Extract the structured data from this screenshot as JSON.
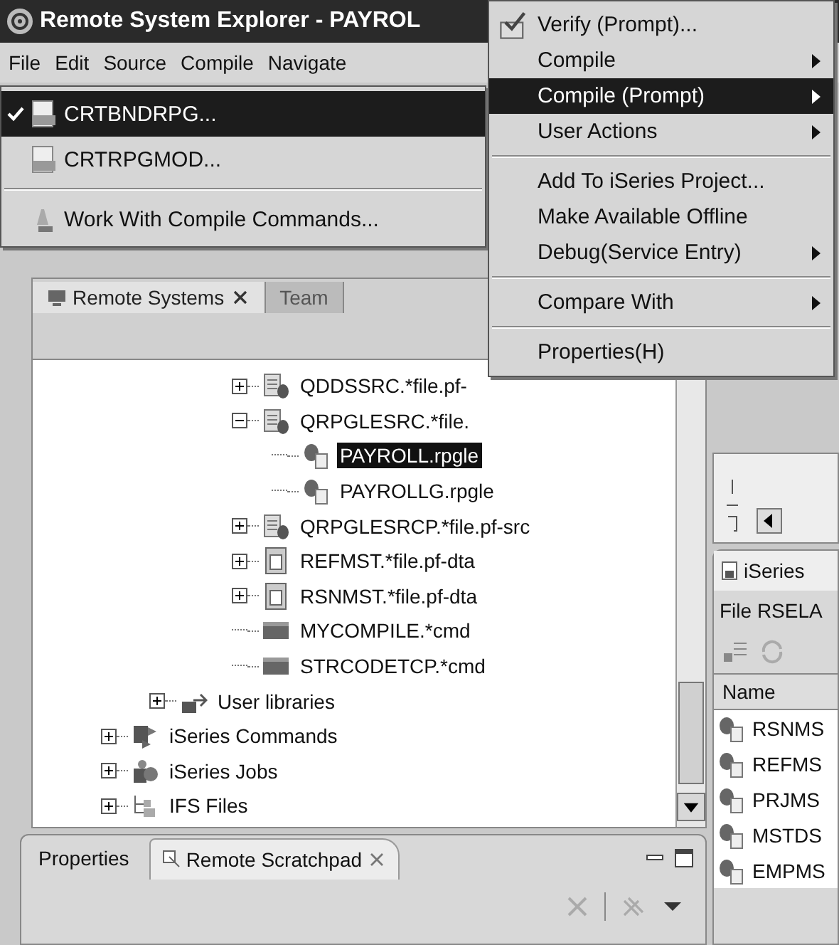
{
  "window": {
    "title": "Remote System Explorer - PAYROL"
  },
  "menu_bar": [
    "File",
    "Edit",
    "Source",
    "Compile",
    "Navigate"
  ],
  "submenu": {
    "items": [
      {
        "kind": "program",
        "label": "CRTBNDRPG...",
        "checked": true,
        "selected": true
      },
      {
        "kind": "program",
        "label": "CRTRPGMOD...",
        "checked": false,
        "selected": false
      },
      {
        "kind": "separator"
      },
      {
        "kind": "commands",
        "label": "Work With Compile Commands...",
        "checked": false,
        "selected": false
      }
    ]
  },
  "context_menu": {
    "items": [
      {
        "kind": "verify",
        "label": "Verify (Prompt)...",
        "submenu": false,
        "selected": false
      },
      {
        "kind": "item",
        "label": "Compile",
        "submenu": true,
        "selected": false
      },
      {
        "kind": "item",
        "label": "Compile (Prompt)",
        "submenu": true,
        "selected": true
      },
      {
        "kind": "item",
        "label": "User Actions",
        "submenu": true,
        "selected": false
      },
      {
        "kind": "separator"
      },
      {
        "kind": "item",
        "label": "Add To iSeries Project...",
        "submenu": false,
        "selected": false
      },
      {
        "kind": "item",
        "label": "Make Available Offline",
        "submenu": false,
        "selected": false
      },
      {
        "kind": "item",
        "label": "Debug(Service Entry)",
        "submenu": true,
        "selected": false
      },
      {
        "kind": "separator"
      },
      {
        "kind": "item",
        "label": "Compare With",
        "submenu": true,
        "selected": false
      },
      {
        "kind": "separator"
      },
      {
        "kind": "item",
        "label": "Properties(H)",
        "submenu": false,
        "selected": false
      }
    ]
  },
  "remote_systems_panel": {
    "tabs": [
      {
        "label": "Remote Systems",
        "selected": true
      },
      {
        "label": "Team",
        "selected": false
      }
    ],
    "tree": [
      {
        "children": [
          {
            "children": [
              {
                "label": "QDDSSRC.*file.pf-",
                "kind": "source-file",
                "expanded": false,
                "selected": false
              },
              {
                "label": "QRPGLESRC.*file.",
                "kind": "source-file",
                "expanded": true,
                "selected": false,
                "children": [
                  {
                    "label": "PAYROLL.rpgle",
                    "kind": "member",
                    "selected": true
                  },
                  {
                    "label": "PAYROLLG.rpgle",
                    "kind": "member",
                    "selected": false
                  }
                ]
              },
              {
                "label": "QRPGLESRCP.*file.pf-src",
                "kind": "source-file",
                "expanded": false,
                "selected": false
              },
              {
                "label": "REFMST.*file.pf-dta",
                "kind": "data-file",
                "expanded": false,
                "selected": false
              },
              {
                "label": "RSNMST.*file.pf-dta",
                "kind": "data-file",
                "expanded": false,
                "selected": false
              },
              {
                "label": "MYCOMPILE.*cmd",
                "kind": "command",
                "selected": false
              },
              {
                "label": "STRCODETCP.*cmd",
                "kind": "command",
                "selected": false
              }
            ]
          },
          {
            "label": "User libraries",
            "kind": "library",
            "expanded": false,
            "selected": false
          }
        ]
      },
      {
        "label": "iSeries Commands",
        "kind": "commands",
        "expanded": false,
        "selected": false
      },
      {
        "label": "iSeries Jobs",
        "kind": "jobs",
        "expanded": false,
        "selected": false
      },
      {
        "label": "IFS Files",
        "kind": "ifs",
        "expanded": false,
        "selected": false
      }
    ]
  },
  "bottom_panel": {
    "tabs": [
      {
        "label": "Properties",
        "selected": false
      },
      {
        "label": "Remote Scratchpad",
        "selected": true
      }
    ]
  },
  "table_panel": {
    "tab": "iSeries",
    "filter": "File RSELA",
    "columns": [
      "Name"
    ],
    "rows": [
      "RSNMS",
      "REFMS",
      "PRJMS",
      "MSTDS",
      "EMPMS"
    ]
  }
}
